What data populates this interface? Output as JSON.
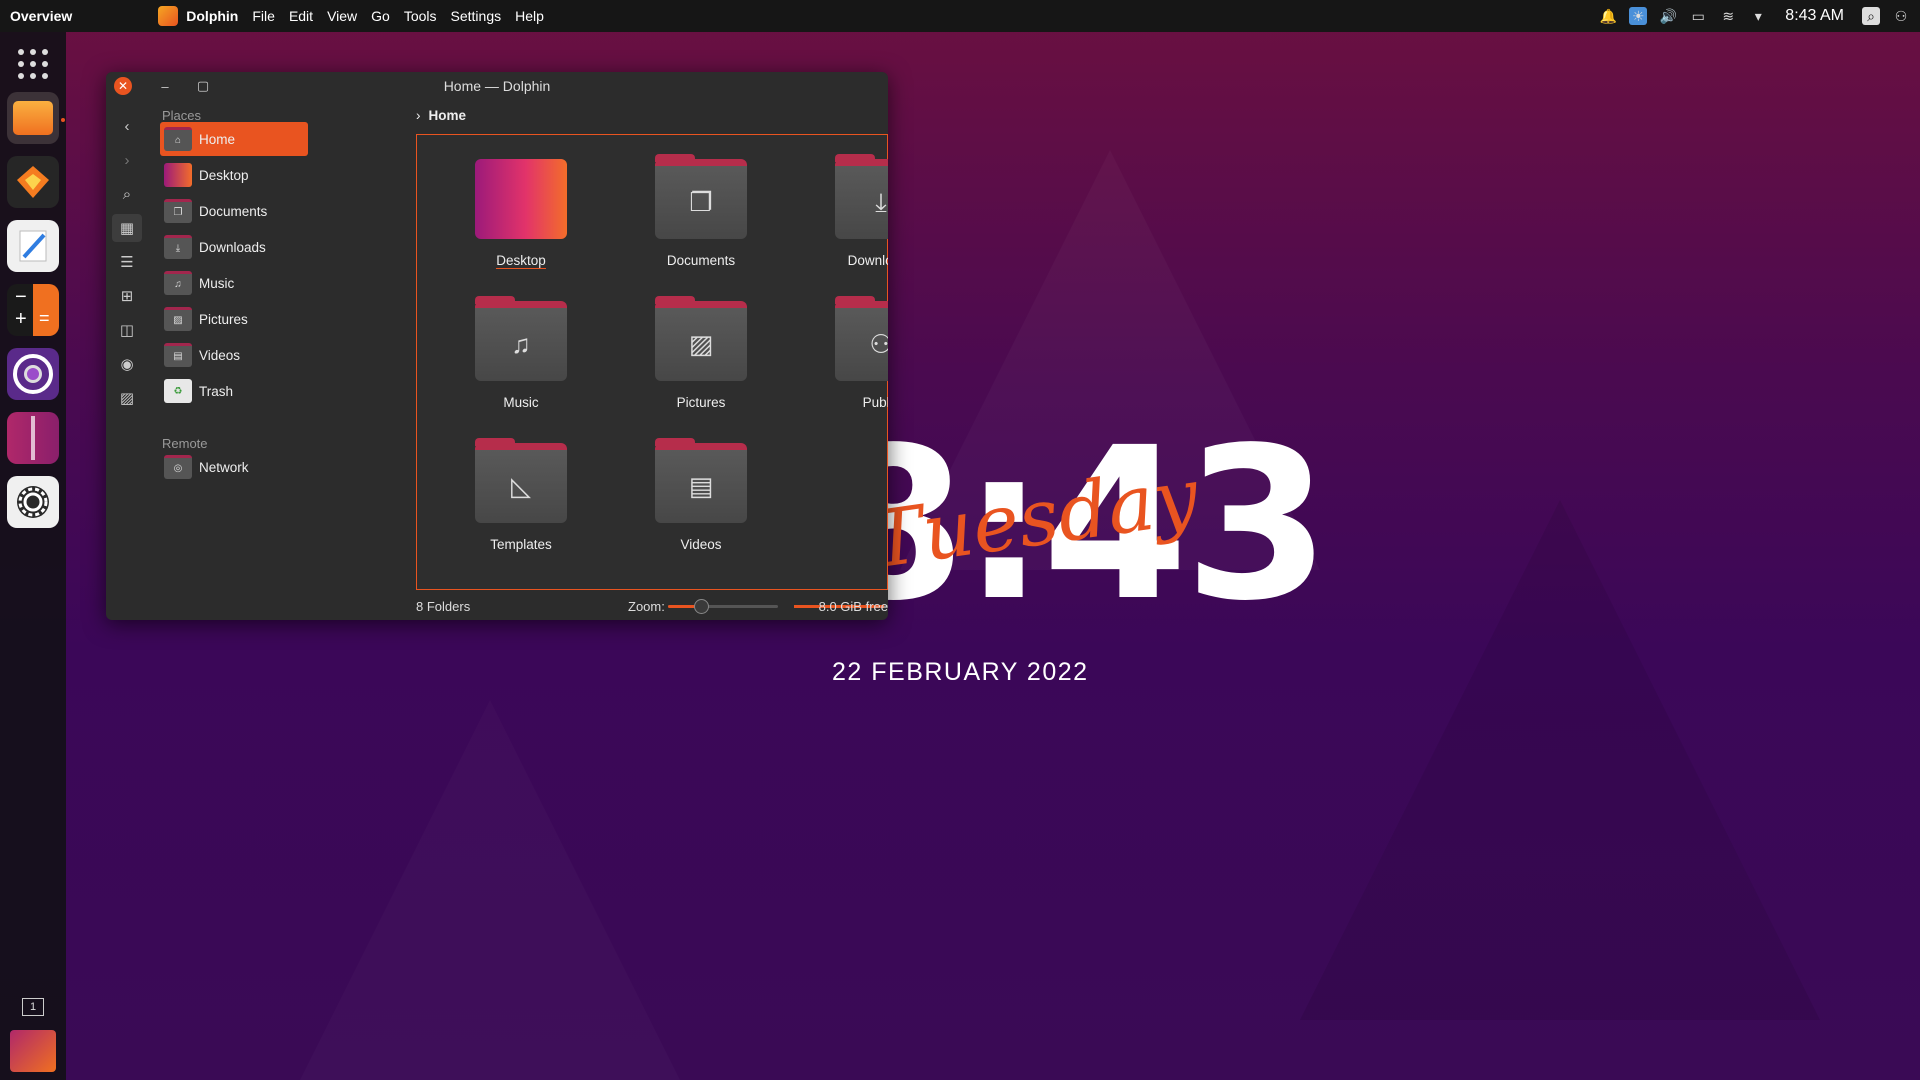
{
  "topbar": {
    "overview": "Overview",
    "app_name": "Dolphin",
    "menus": [
      "File",
      "Edit",
      "View",
      "Go",
      "Tools",
      "Settings",
      "Help"
    ],
    "time": "8:43 AM"
  },
  "desktop": {
    "clock_time": "8:43",
    "clock_day": "Tuesday",
    "clock_date": "22 FEBRUARY 2022"
  },
  "window": {
    "title": "Home — Dolphin",
    "breadcrumb": "Home",
    "places_label": "Places",
    "remote_label": "Remote",
    "places": [
      "Home",
      "Desktop",
      "Documents",
      "Downloads",
      "Music",
      "Pictures",
      "Videos",
      "Trash"
    ],
    "remote": [
      "Network"
    ],
    "folders": [
      "Desktop",
      "Documents",
      "Downloads",
      "Music",
      "Pictures",
      "Public",
      "Templates",
      "Videos"
    ],
    "status": {
      "count": "8 Folders",
      "zoom_label": "Zoom:",
      "zoom_level": 0.3,
      "free": "8.0 GiB free",
      "used_fraction": 0.75
    }
  },
  "workspace_indicator": "1",
  "colors": {
    "accent": "#e95420",
    "folder_tab": "#b62d4b"
  }
}
